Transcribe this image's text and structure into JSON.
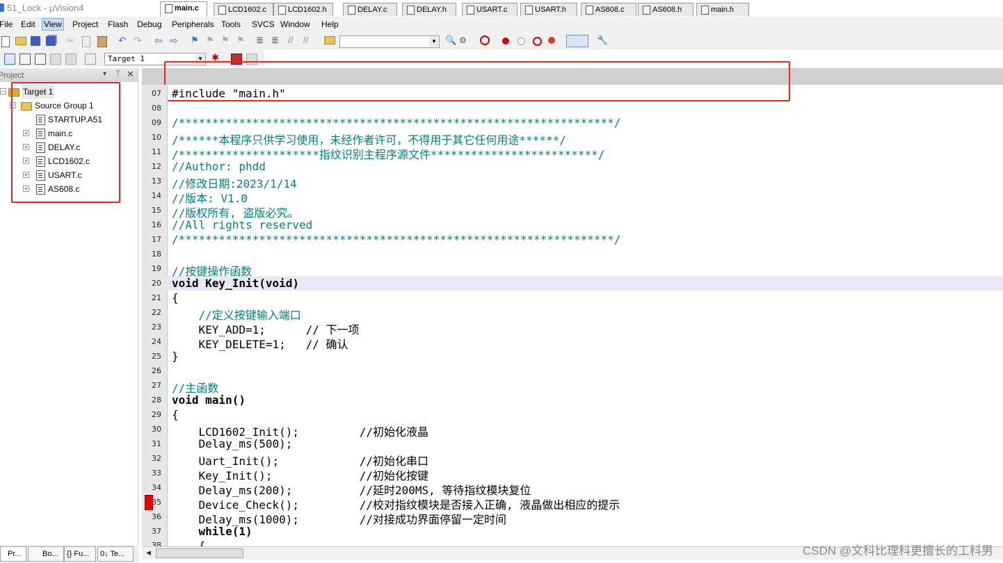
{
  "window": {
    "title": "51_Lock  - µVision4"
  },
  "menu": [
    "File",
    "Edit",
    "View",
    "Project",
    "Flash",
    "Debug",
    "Peripherals",
    "Tools",
    "SVCS",
    "Window",
    "Help"
  ],
  "toolbar": {
    "target_combo": "Target 1"
  },
  "project_panel": {
    "title": "Project",
    "target": "Target 1",
    "group": "Source Group 1",
    "files": [
      "STARTUP.A51",
      "main.c",
      "DELAY.c",
      "LCD1602.c",
      "USART.c",
      "AS608.c"
    ]
  },
  "bottom_tabs": [
    "Pr...",
    "Bo...",
    "{} Fu...",
    "0↓ Te..."
  ],
  "editor": {
    "tabs": [
      "main.c",
      "LCD1602.c",
      "LCD1602.h",
      "DELAY.c",
      "DELAY.h",
      "USART.c",
      "USART.h",
      "AS608.c",
      "AS608.h",
      "main.h"
    ],
    "active_tab": "main.c",
    "line_numbers": [
      "07",
      "08",
      "09",
      "10",
      "11",
      "12",
      "13",
      "14",
      "15",
      "16",
      "17",
      "18",
      "19",
      "20",
      "21",
      "22",
      "23",
      "24",
      "25",
      "26",
      "27",
      "28",
      "29",
      "30",
      "31",
      "32",
      "33",
      "34",
      "35",
      "36",
      "37",
      "38"
    ],
    "lines": [
      "#include \"main.h\"",
      "",
      "/*****************************************************************/",
      "/******本程序只供学习使用，未经作者许可，不得用于其它任何用途******/",
      "/*********************指纹识别主程序源文件*************************/",
      "//Author: phdd",
      "//修改日期:2023/1/14",
      "//版本: V1.0",
      "//版权所有, 盗版必究。",
      "//All rights reserved",
      "/*****************************************************************/",
      "",
      "//按键操作函数",
      "void Key_Init(void)",
      "{",
      "    //定义按键输入端口",
      "    KEY_ADD=1;      // 下一项",
      "    KEY_DELETE=1;   // 确认",
      "}",
      "",
      "//主函数",
      "void main()",
      "{",
      "    LCD1602_Init();         //初始化液晶",
      "    Delay_ms(500);",
      "    Uart_Init();            //初始化串口",
      "    Key_Init();             //初始化按键",
      "    Delay_ms(200);          //延时200MS, 等待指纹模块复位",
      "    Device_Check();         //校对指纹模块是否接入正确, 液晶做出相应的提示",
      "    Delay_ms(1000);         //对接成功界面停留一定时间",
      "    while(1)",
      "    {"
    ]
  },
  "watermark": "CSDN @文科比理科更擅长的工科男"
}
